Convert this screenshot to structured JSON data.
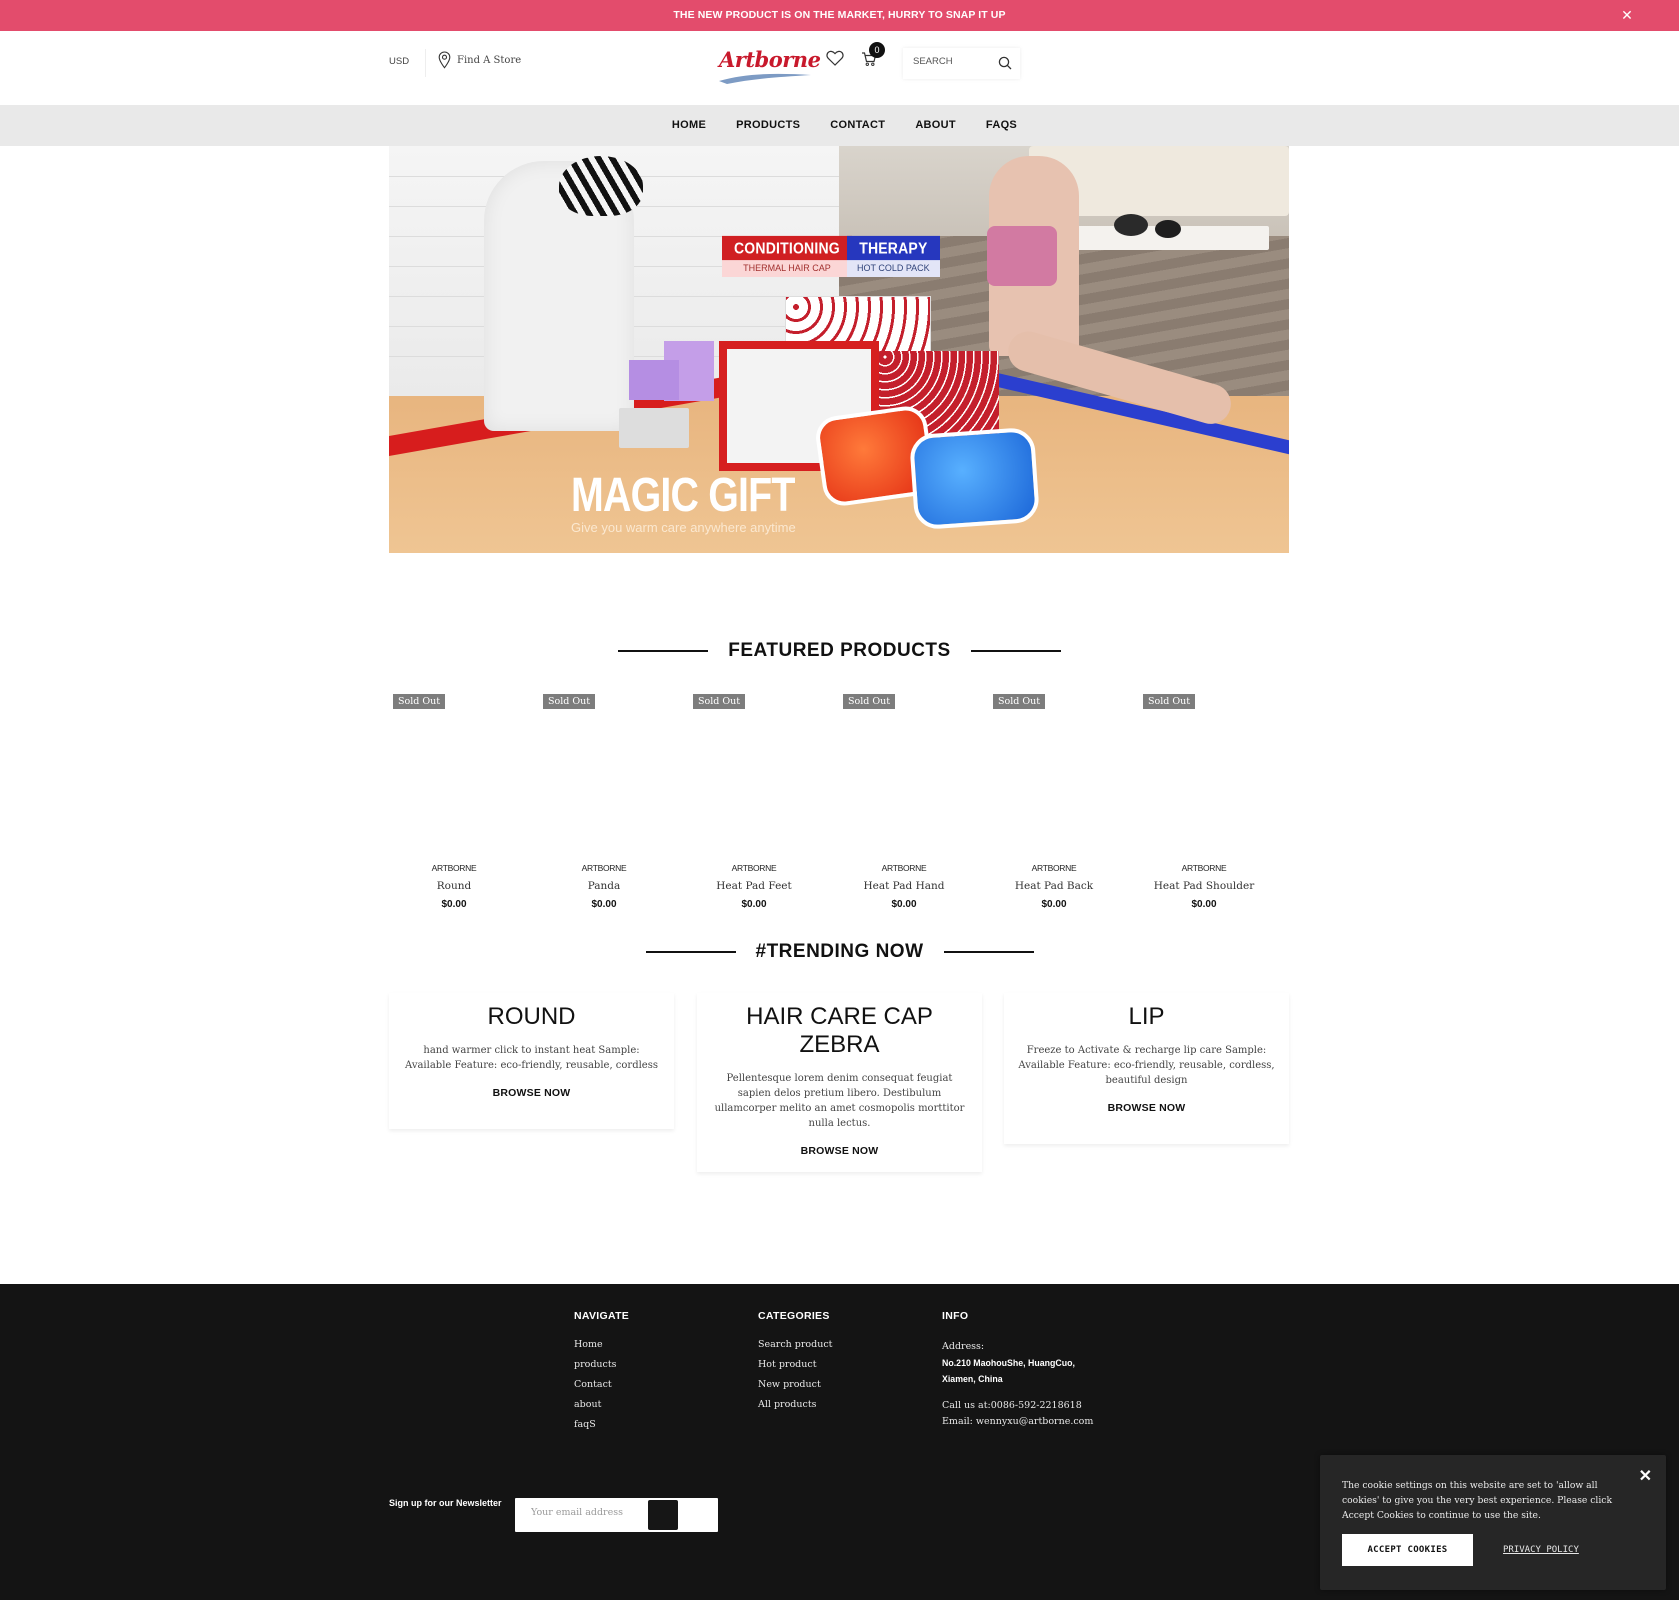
{
  "announcement": {
    "text": "THE NEW PRODUCT IS ON THE MARKET, HURRY TO SNAP IT UP",
    "close_label": "✕"
  },
  "header": {
    "currency": "USD",
    "find_store": "Find A Store",
    "logo_text": "Artborne",
    "cart_count": "0",
    "search_placeholder": "SEARCH"
  },
  "nav": {
    "items": [
      {
        "label": "HOME"
      },
      {
        "label": "PRODUCTS"
      },
      {
        "label": "CONTACT"
      },
      {
        "label": "ABOUT"
      },
      {
        "label": "FAQS"
      }
    ]
  },
  "hero": {
    "tag_left_title": "CONDITIONING",
    "tag_left_sub": "THERMAL HAIR CAP",
    "tag_right_title": "THERAPY",
    "tag_right_sub": "HOT COLD PACK",
    "headline": "MAGIC GIFT",
    "subline": "Give you warm care anywhere anytime"
  },
  "featured": {
    "title": "FEATURED PRODUCTS",
    "products": [
      {
        "badge": "Sold Out",
        "vendor": "ARTBORNE",
        "name": "Round",
        "price": "$0.00"
      },
      {
        "badge": "Sold Out",
        "vendor": "ARTBORNE",
        "name": "Panda",
        "price": "$0.00"
      },
      {
        "badge": "Sold Out",
        "vendor": "ARTBORNE",
        "name": "Heat Pad Feet",
        "price": "$0.00"
      },
      {
        "badge": "Sold Out",
        "vendor": "ARTBORNE",
        "name": "Heat Pad Hand",
        "price": "$0.00"
      },
      {
        "badge": "Sold Out",
        "vendor": "ARTBORNE",
        "name": "Heat Pad Back",
        "price": "$0.00"
      },
      {
        "badge": "Sold Out",
        "vendor": "ARTBORNE",
        "name": "Heat Pad Shoulder",
        "price": "$0.00"
      }
    ]
  },
  "trending": {
    "title": "#TRENDING NOW",
    "cards": [
      {
        "title": "ROUND",
        "text": "hand warmer click to instant heat Sample: Available Feature: eco-friendly, reusable, cordless",
        "cta": "BROWSE NOW"
      },
      {
        "title": "HAIR CARE CAP ZEBRA",
        "text": "Pellentesque lorem denim consequat feugiat sapien delos pretium libero. Destibulum ullamcorper melito an amet cosmopolis morttitor nulla lectus.",
        "cta": "BROWSE NOW"
      },
      {
        "title": "LIP",
        "text": "Freeze to Activate & recharge lip care Sample: Available Feature: eco-friendly, reusable, cordless, beautiful design",
        "cta": "BROWSE NOW"
      }
    ]
  },
  "footer": {
    "navigate": {
      "title": "NAVIGATE",
      "links": [
        "Home",
        "products",
        "Contact",
        "about",
        "faqS"
      ]
    },
    "categories": {
      "title": "CATEGORIES",
      "links": [
        "Search product",
        "Hot product",
        "New product",
        "All products"
      ]
    },
    "info": {
      "title": "INFO",
      "address_label": "Address:",
      "address_line1": "No.210 MaohouShe, HuangCuo,",
      "address_line2": "Xiamen, China",
      "phone": "Call us at:0086-592-2218618",
      "email": "Email: wennyxu@artborne.com"
    },
    "newsletter": {
      "label": "Sign up for our Newsletter",
      "placeholder": "Your email address"
    }
  },
  "cookie": {
    "text": "The cookie settings on this website are set to 'allow all cookies' to give you the very best experience. Please click Accept Cookies to continue to use the site.",
    "accept": "ACCEPT COOKIES",
    "privacy": "PRIVACY POLICY",
    "close_label": "✕"
  },
  "colors": {
    "announcement_bg": "#e34c6c",
    "nav_bg": "#e9e9e9",
    "footer_bg": "#141414",
    "badge_bg": "#7d7d7d",
    "logo_red": "#c8192c"
  }
}
